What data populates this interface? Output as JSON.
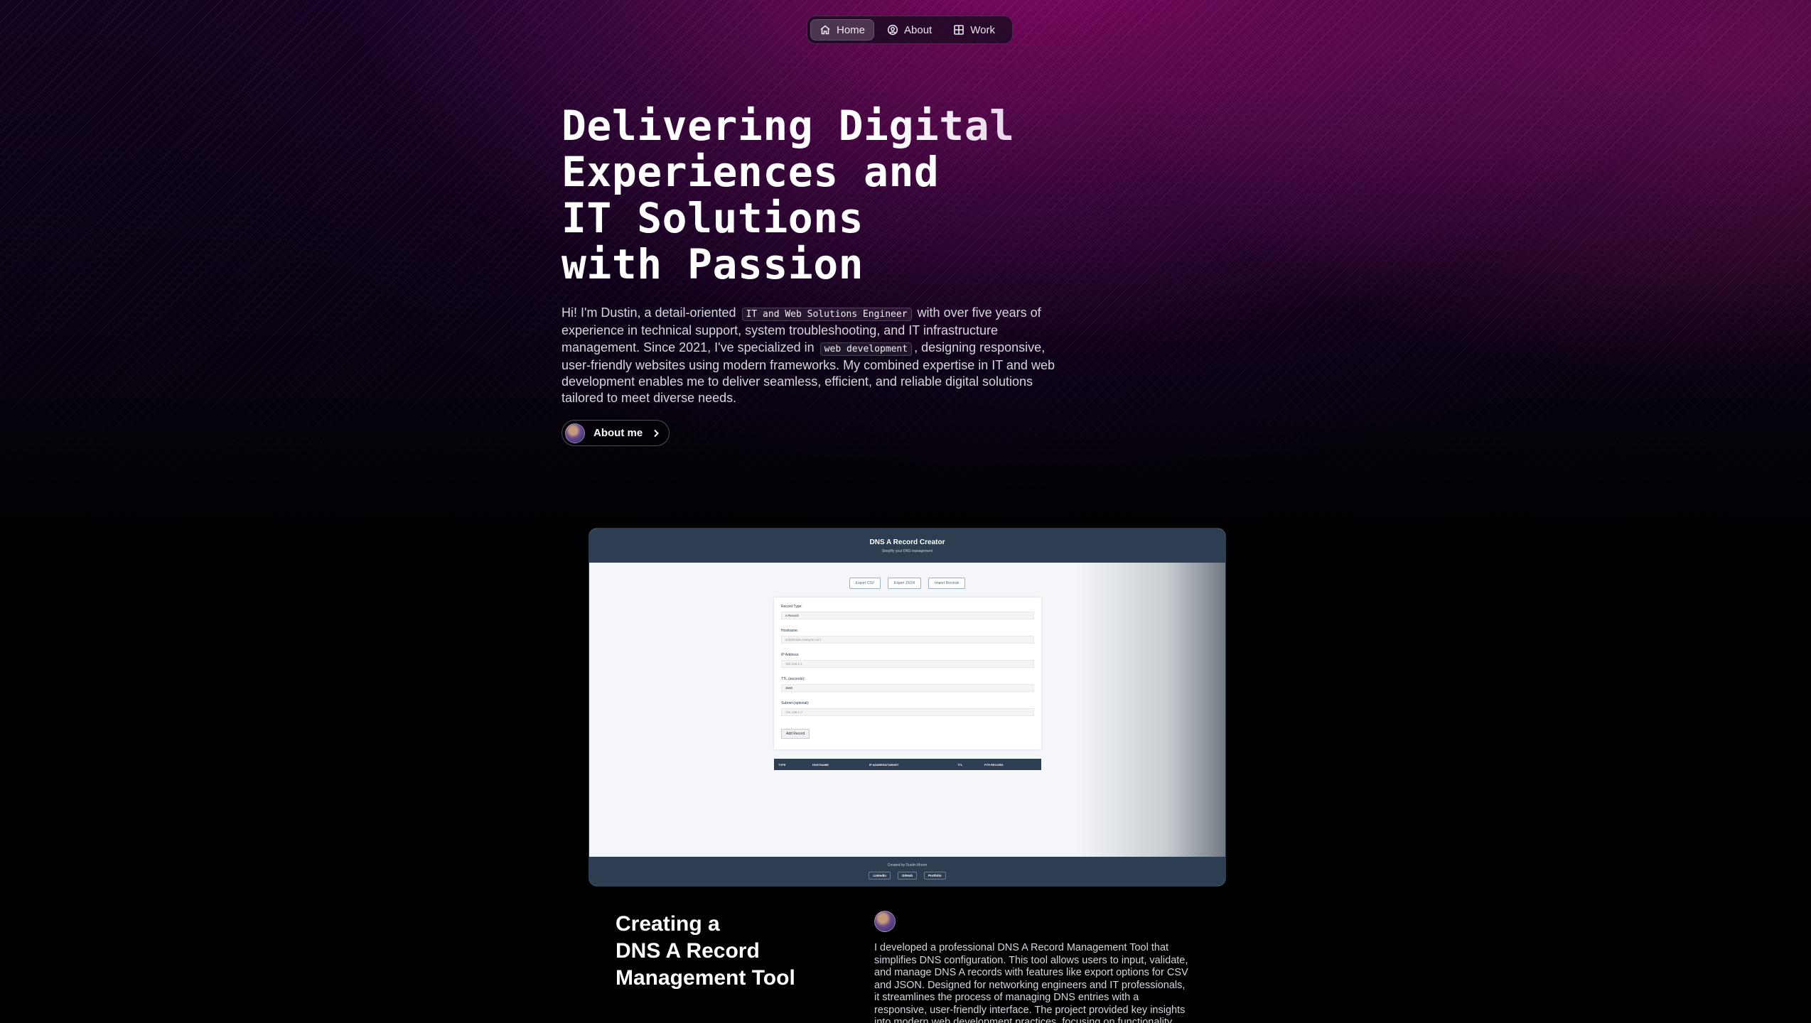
{
  "nav": {
    "items": [
      {
        "label": "Home",
        "icon": "home-icon",
        "active": true
      },
      {
        "label": "About",
        "icon": "user-circle-icon",
        "active": false
      },
      {
        "label": "Work",
        "icon": "grid-icon",
        "active": false
      }
    ]
  },
  "hero": {
    "title_lines": [
      "Delivering Digital",
      "Experiences and",
      "IT Solutions",
      "with Passion"
    ],
    "intro_1": "Hi! I'm Dustin, a detail-oriented",
    "code_1": "IT and Web Solutions Engineer",
    "intro_2": "with over five years of experience in technical support, system troubleshooting, and IT infrastructure management. Since 2021, I've specialized in",
    "code_2": "web development",
    "intro_3": ", designing responsive, user-friendly websites using modern frameworks. My combined expertise in IT and web development enables me to deliver seamless, efficient, and reliable digital solutions tailored to meet diverse needs.",
    "about_button": "About me"
  },
  "preview": {
    "title": "DNS A Record Creator",
    "subtitle": "Simplify your DNS management",
    "buttons": [
      "Export CSV",
      "Export JSON",
      "Import Records"
    ],
    "fields": [
      {
        "label": "Record Type:",
        "value": "A Record"
      },
      {
        "label": "Hostname:",
        "value": "subdomain.example.com"
      },
      {
        "label": "IP Address:",
        "value": "192.168.1.1"
      },
      {
        "label": "TTL (seconds):",
        "value": "3600"
      },
      {
        "label": "Subnet (optional):",
        "value": "192.168.1.0"
      }
    ],
    "submit": "Add Record",
    "table_headers": [
      "TYPE",
      "HOSTNAME",
      "IP ADDRESS/TARGET",
      "TTL",
      "PTR RECORD"
    ],
    "footer_text": "Created by Dustin Moore",
    "footer_links": [
      "LinkedIn",
      "GitHub",
      "Portfolio"
    ]
  },
  "project": {
    "title_lines": [
      "Creating a",
      "DNS A Record",
      "Management Tool"
    ],
    "description": "I developed a professional DNS A Record Management Tool that simplifies DNS configuration. This tool allows users to input, validate, and manage DNS A records with features like export options for CSV and JSON. Designed for networking engineers and IT professionals, it streamlines the process of managing DNS entries with a responsive, user-friendly interface. The project provided key insights into modern web development practices, focusing on functionality, validation, and"
  }
}
